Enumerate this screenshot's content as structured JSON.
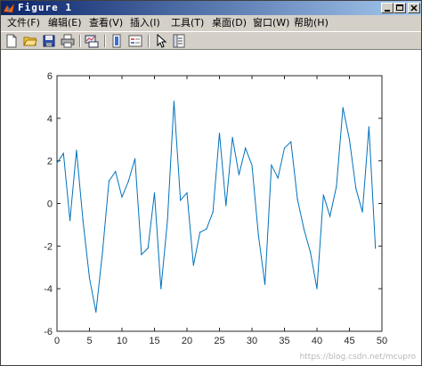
{
  "window": {
    "title": "Figure 1",
    "controls": [
      "minimize",
      "maximize",
      "close"
    ]
  },
  "menu": [
    {
      "label": "文件(F)"
    },
    {
      "label": "编辑(E)"
    },
    {
      "label": "查看(V)"
    },
    {
      "label": "插入(I)"
    },
    {
      "label": "工具(T)"
    },
    {
      "label": "桌面(D)"
    },
    {
      "label": "窗口(W)"
    },
    {
      "label": "帮助(H)"
    }
  ],
  "toolbar": {
    "icons": [
      "new-figure-icon",
      "open-file-icon",
      "save-icon",
      "print-icon",
      "link-plot-icon",
      "colorbar-icon",
      "legend-icon",
      "pointer-icon",
      "property-inspector-icon"
    ]
  },
  "chart_data": {
    "type": "line",
    "title": "",
    "xlabel": "",
    "ylabel": "",
    "xlim": [
      0,
      50
    ],
    "ylim": [
      -6,
      6
    ],
    "xticks": [
      0,
      5,
      10,
      15,
      20,
      25,
      30,
      35,
      40,
      45,
      50
    ],
    "yticks": [
      -6,
      -4,
      -2,
      0,
      2,
      4,
      6
    ],
    "grid": false,
    "line_color": "#0072bd",
    "series": [
      {
        "x": [
          0,
          1,
          2,
          3,
          4,
          5,
          6,
          7,
          8,
          9,
          10,
          11,
          12,
          13,
          14,
          15,
          16,
          17,
          18,
          19,
          20,
          21,
          22,
          23,
          24,
          25,
          26,
          27,
          28,
          29,
          30,
          31,
          32,
          33,
          34,
          35,
          36,
          37,
          38,
          39,
          40,
          41,
          42,
          43,
          44,
          45,
          46,
          47,
          48,
          49
        ],
        "values": [
          1.9,
          2.35,
          -0.8,
          2.5,
          -0.8,
          -3.5,
          -5.1,
          -2.3,
          1.05,
          1.5,
          0.3,
          1.05,
          2.1,
          -2.4,
          -2.1,
          0.5,
          -4.0,
          -0.8,
          4.8,
          0.15,
          0.5,
          -2.9,
          -1.35,
          -1.2,
          -0.4,
          3.3,
          -0.1,
          3.1,
          1.35,
          2.6,
          1.8,
          -1.5,
          -3.8,
          1.8,
          1.2,
          2.6,
          2.9,
          0.2,
          -1.2,
          -2.3,
          -4.0,
          0.4,
          -0.6,
          0.8,
          4.5,
          3.0,
          0.7,
          -0.4,
          3.6,
          -2.1
        ]
      }
    ]
  },
  "watermark": "https://blog.csdn.net/mcupro"
}
